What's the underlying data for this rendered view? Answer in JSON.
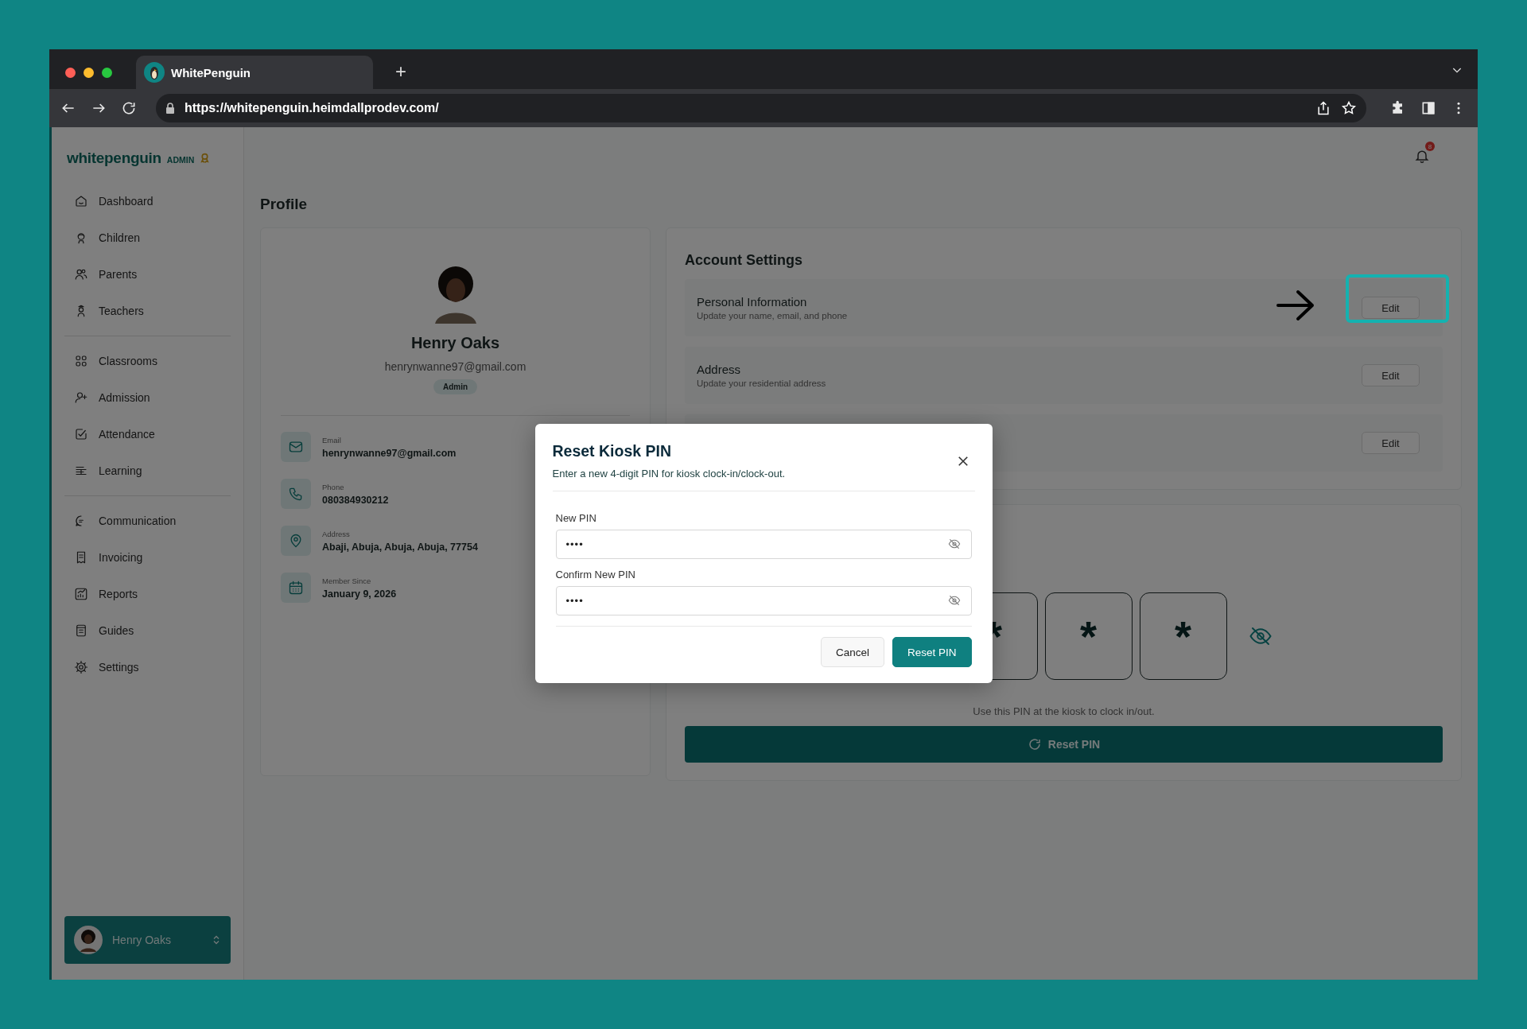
{
  "browser": {
    "tab_title": "WhitePenguin",
    "new_tab": "+",
    "url": "https://whitepenguin.heimdallprodev.com/"
  },
  "sidebar": {
    "logo": "whitepenguin",
    "role": "ADMIN",
    "groups": [
      [
        "Dashboard",
        "Children",
        "Parents",
        "Teachers"
      ],
      [
        "Classrooms",
        "Admission",
        "Attendance",
        "Learning"
      ],
      [
        "Communication",
        "Invoicing",
        "Reports",
        "Guides",
        "Settings"
      ]
    ],
    "user": {
      "name": "Henry Oaks"
    }
  },
  "header": {
    "notification_count": "8"
  },
  "page_title": "Profile",
  "profile": {
    "name": "Henry Oaks",
    "email": "henrynwanne97@gmail.com",
    "role_badge": "Admin",
    "details": [
      {
        "label": "Email",
        "value": "henrynwanne97@gmail.com"
      },
      {
        "label": "Phone",
        "value": "080384930212"
      },
      {
        "label": "Address",
        "value": "Abaji, Abuja, Abuja, Abuja, 77754"
      },
      {
        "label": "Member Since",
        "value": "January 9, 2026"
      }
    ]
  },
  "account_settings": {
    "title": "Account Settings",
    "rows": [
      {
        "title": "Personal Information",
        "subtitle": "Update your name, email, and phone",
        "action": "Edit",
        "highlighted": true
      },
      {
        "title": "Address",
        "subtitle": "Update your residential address",
        "action": "Edit",
        "highlighted": false
      },
      {
        "action": "Edit",
        "highlighted": false
      }
    ]
  },
  "kiosk_pin": {
    "digits": [
      "*",
      "*",
      "*"
    ],
    "hint": "Use this PIN at the kiosk to clock in/out.",
    "button": "Reset PIN"
  },
  "modal": {
    "title": "Reset Kiosk PIN",
    "subtitle": "Enter a new 4-digit PIN for kiosk clock-in/clock-out.",
    "fields": [
      {
        "label": "New PIN",
        "value": "••••"
      },
      {
        "label": "Confirm New PIN",
        "value": "••••"
      }
    ],
    "buttons": [
      {
        "label": "Cancel",
        "kind": "secondary"
      },
      {
        "label": "Reset PIN",
        "kind": "primary"
      }
    ]
  }
}
